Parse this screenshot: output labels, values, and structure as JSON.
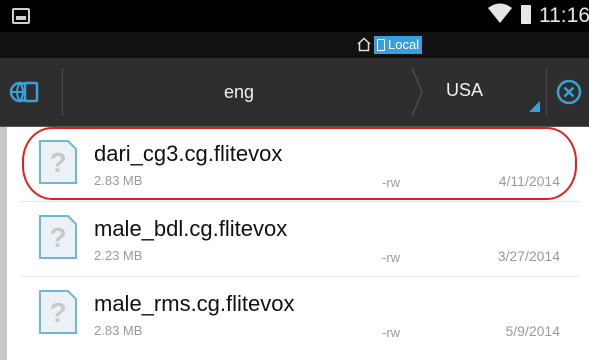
{
  "status_bar": {
    "time": "11:16",
    "icons": [
      "image-notification-icon",
      "wifi-icon",
      "battery-icon"
    ]
  },
  "breadcrumb": {
    "home_icon": "home-icon",
    "location_icon": "phone-icon",
    "location_label": "Local"
  },
  "toolbar": {
    "globe_icon": "globe-icon",
    "language": "eng",
    "region": "USA",
    "close_icon": "close-circle-icon",
    "accent_color": "#3aa0da"
  },
  "files": [
    {
      "name": "dari_cg3.cg.flitevox",
      "size": "2.83 MB",
      "permissions": "-rw",
      "date": "4/11/2014",
      "highlighted": true
    },
    {
      "name": "male_bdl.cg.flitevox",
      "size": "2.23 MB",
      "permissions": "-rw",
      "date": "3/27/2014",
      "highlighted": false
    },
    {
      "name": "male_rms.cg.flitevox",
      "size": "2.83 MB",
      "permissions": "-rw",
      "date": "5/9/2014",
      "highlighted": false
    }
  ],
  "file_icon": "unknown-file-icon",
  "highlight_color": "#e02020"
}
